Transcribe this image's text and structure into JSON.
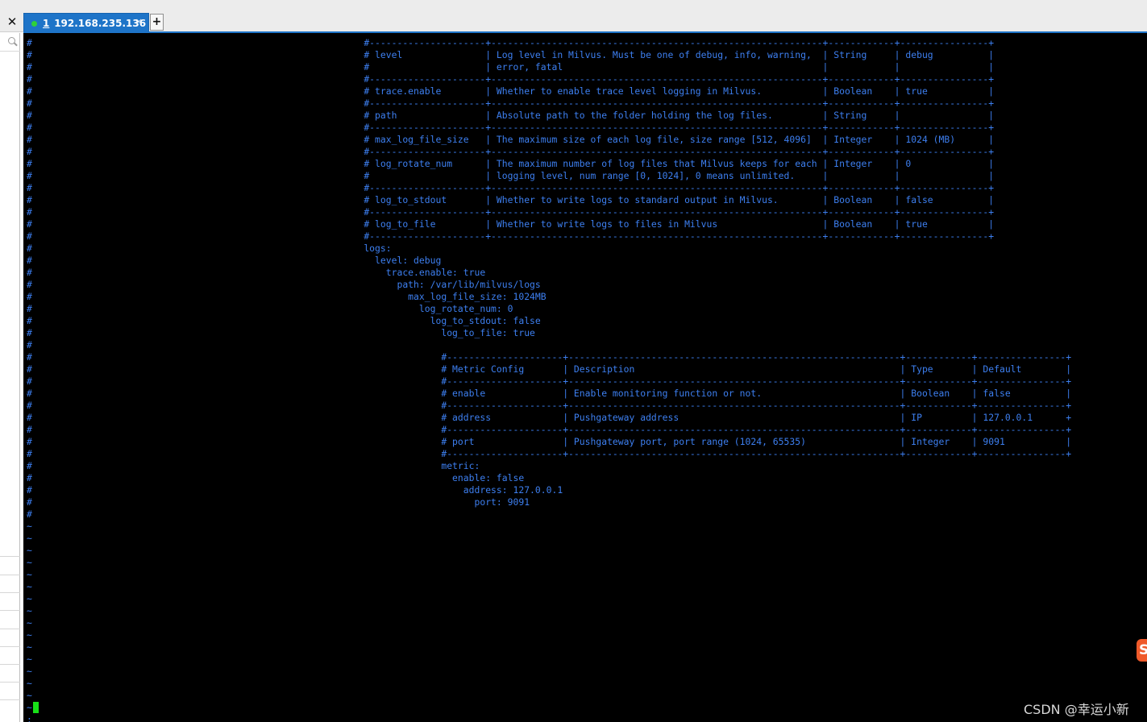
{
  "tab": {
    "index": "1",
    "title": "192.168.235.136",
    "close_glyph": "×",
    "status_color": "#2fd13a"
  },
  "window": {
    "close_glyph": "✕",
    "new_tab_glyph": "+"
  },
  "terminal": {
    "lines": [
      "#                                                            #---------------------+------------------------------------------------------------+------------+----------------+",
      "#                                                            # level               | Log level in Milvus. Must be one of debug, info, warning,  | String     | debug          |",
      "#                                                            #                     | error, fatal                                               |            |                |",
      "#                                                            #---------------------+------------------------------------------------------------+------------+----------------+",
      "#                                                            # trace.enable        | Whether to enable trace level logging in Milvus.           | Boolean    | true           |",
      "#                                                            #---------------------+------------------------------------------------------------+------------+----------------+",
      "#                                                            # path                | Absolute path to the folder holding the log files.         | String     |                |",
      "#                                                            #---------------------+------------------------------------------------------------+------------+----------------+",
      "#                                                            # max_log_file_size   | The maximum size of each log file, size range [512, 4096]  | Integer    | 1024 (MB)      |",
      "#                                                            #---------------------+------------------------------------------------------------+------------+----------------+",
      "#                                                            # log_rotate_num      | The maximum number of log files that Milvus keeps for each | Integer    | 0              |",
      "#                                                            #                     | logging level, num range [0, 1024], 0 means unlimited.     |            |                |",
      "#                                                            #---------------------+------------------------------------------------------------+------------+----------------+",
      "#                                                            # log_to_stdout       | Whether to write logs to standard output in Milvus.        | Boolean    | false          |",
      "#                                                            #---------------------+------------------------------------------------------------+------------+----------------+",
      "#                                                            # log_to_file         | Whether to write logs to files in Milvus                   | Boolean    | true           |",
      "#                                                            #---------------------+------------------------------------------------------------+------------+----------------+",
      "#                                                            logs:",
      "#                                                              level: debug",
      "#                                                                trace.enable: true",
      "#                                                                  path: /var/lib/milvus/logs",
      "#                                                                    max_log_file_size: 1024MB",
      "#                                                                      log_rotate_num: 0",
      "#                                                                        log_to_stdout: false",
      "#                                                                          log_to_file: true",
      "#",
      "#                                                                          #---------------------+------------------------------------------------------------+------------+----------------+",
      "#                                                                          # Metric Config       | Description                                                | Type       | Default        |",
      "#                                                                          #---------------------+------------------------------------------------------------+------------+----------------+",
      "#                                                                          # enable              | Enable monitoring function or not.                         | Boolean    | false          |",
      "#                                                                          #---------------------+------------------------------------------------------------+------------+----------------+",
      "#                                                                          # address             | Pushgateway address                                        | IP         | 127.0.0.1      +",
      "#                                                                          #---------------------+------------------------------------------------------------+------------+----------------+",
      "#                                                                          # port                | Pushgateway port, port range (1024, 65535)                 | Integer    | 9091           |",
      "#                                                                          #---------------------+------------------------------------------------------------+------------+----------------+",
      "#                                                                          metric:",
      "#                                                                            enable: false",
      "#                                                                              address: 127.0.0.1",
      "#                                                                                port: 9091",
      "#",
      "~",
      "~",
      "~",
      "~",
      "~",
      "~",
      "~",
      "~",
      "~",
      "~",
      "~",
      "~",
      "~",
      "~",
      "~",
      "~",
      ":"
    ]
  },
  "watermark": "CSDN @幸运小新",
  "badge": "S",
  "colors": {
    "tab_blue": "#1e74c8",
    "terminal_text": "#3d7ff0",
    "cursor": "#18e018",
    "badge": "#ef5a2a"
  }
}
